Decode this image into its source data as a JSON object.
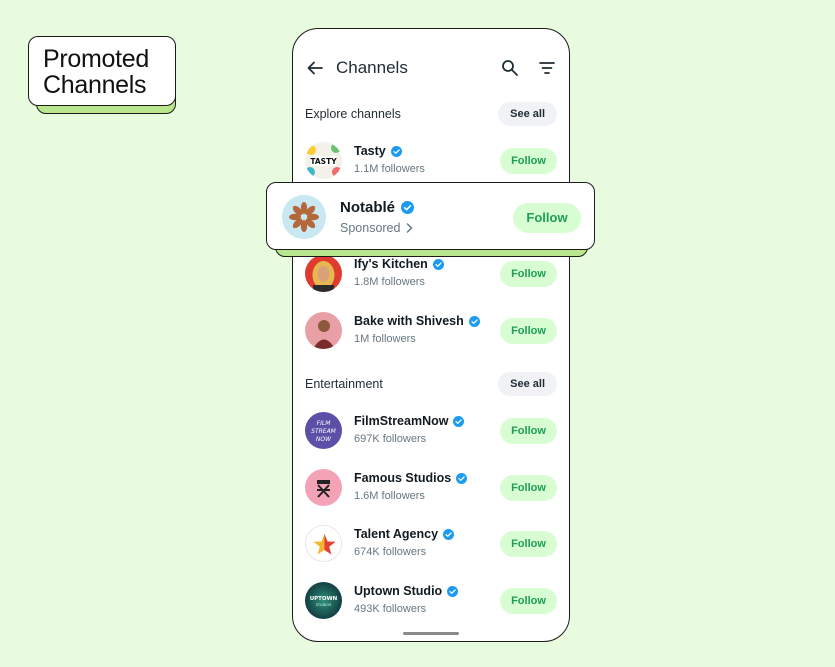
{
  "promo": {
    "line1": "Promoted",
    "line2": "Channels"
  },
  "header": {
    "title": "Channels"
  },
  "sections": [
    {
      "title": "Explore channels",
      "see_all": "See all"
    },
    {
      "title": "Entertainment",
      "see_all": "See all"
    }
  ],
  "highlight": {
    "name": "Notablé",
    "sub": "Sponsored",
    "follow": "Follow",
    "avatar_color": "#c9e8f2",
    "logo_color": "#b3673a"
  },
  "channels": [
    {
      "name": "Tasty",
      "followers": "1.1M followers",
      "follow": "Follow",
      "avatar_text": "TASTY"
    },
    {
      "name": "Ify's Kitchen",
      "followers": "1.8M followers",
      "follow": "Follow"
    },
    {
      "name": "Bake with Shivesh",
      "followers": "1M followers",
      "follow": "Follow"
    },
    {
      "name": "FilmStreamNow",
      "followers": "697K followers",
      "follow": "Follow",
      "avatar_text": "FILM STREAM NOW"
    },
    {
      "name": "Famous Studios",
      "followers": "1.6M followers",
      "follow": "Follow"
    },
    {
      "name": "Talent Agency",
      "followers": "674K followers",
      "follow": "Follow"
    },
    {
      "name": "Uptown Studio",
      "followers": "493K followers",
      "follow": "Follow",
      "avatar_text": "UPTOWN STUDIOS"
    }
  ],
  "colors": {
    "background": "#e8fbdf",
    "accent_green": "#1d9f55",
    "follow_bg": "#d8fdd2",
    "verified_blue": "#1d9bf0",
    "shadow_green": "#b9e68c"
  }
}
